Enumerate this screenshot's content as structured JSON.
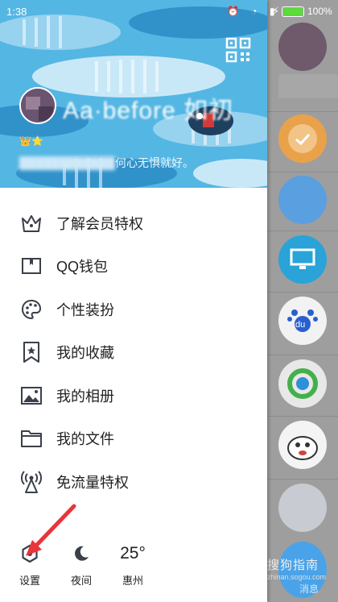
{
  "status_bar": {
    "time": "1:38",
    "battery_percent": "100%"
  },
  "profile": {
    "nickname": "Aa·before 如初",
    "signature_visible": "何心无惧就好。",
    "badges": [
      "crown",
      "star"
    ]
  },
  "menu": {
    "items": [
      {
        "label": "了解会员特权",
        "icon": "crown-icon"
      },
      {
        "label": "QQ钱包",
        "icon": "wallet-icon"
      },
      {
        "label": "个性装扮",
        "icon": "palette-icon"
      },
      {
        "label": "我的收藏",
        "icon": "bookmark-star-icon"
      },
      {
        "label": "我的相册",
        "icon": "photo-album-icon"
      },
      {
        "label": "我的文件",
        "icon": "folder-icon"
      },
      {
        "label": "免流量特权",
        "icon": "antenna-icon"
      }
    ]
  },
  "footer": {
    "settings_label": "设置",
    "night_label": "夜间",
    "temperature": "25°",
    "city": "惠州"
  },
  "background": {
    "message_tab_label": "消息",
    "watermark": "搜狗指南",
    "watermark_url": "zhinan.sogou.com"
  },
  "colors": {
    "header_bg": "#54b6e3",
    "icon_color": "#3a3f4a",
    "arrow_red": "#e8343a"
  }
}
